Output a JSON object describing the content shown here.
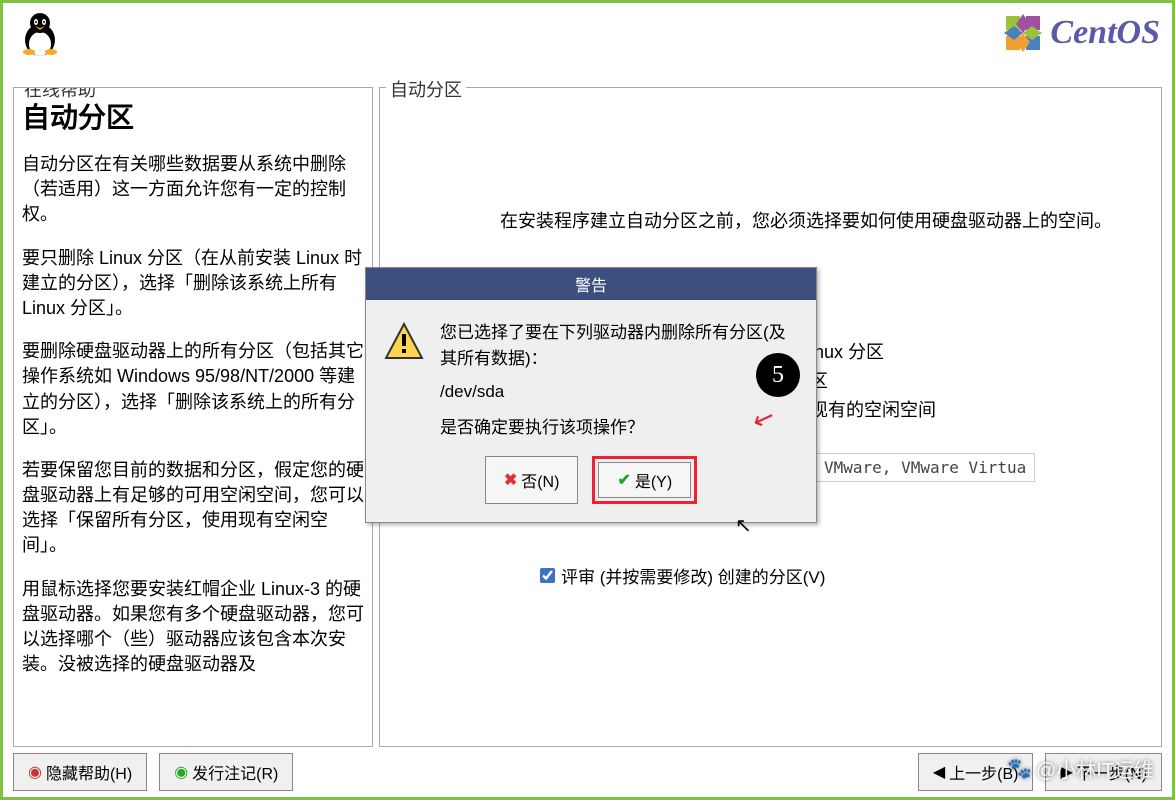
{
  "brand": {
    "name": "CentOS"
  },
  "help": {
    "label": "在线帮助",
    "title": "自动分区",
    "paragraphs": [
      "自动分区在有关哪些数据要从系统中删除（若适用）这一方面允许您有一定的控制权。",
      "要只删除 Linux 分区（在从前安装 Linux 时建立的分区），选择「删除该系统上所有 Linux 分区」。",
      "要删除硬盘驱动器上的所有分区（包括其它操作系统如 Windows 95/98/NT/2000 等建立的分区），选择「删除该系统上的所有分区」。",
      "若要保留您目前的数据和分区，假定您的硬盘驱动器上有足够的可用空闲空间，您可以选择「保留所有分区，使用现有空闲空间」。",
      "用鼠标选择您要安装红帽企业 Linux-3 的硬盘驱动器。如果您有多个硬盘驱动器，您可以选择哪个（些）驱动器应该包含本次安装。没被选择的硬盘驱动器及"
    ]
  },
  "main": {
    "label": "自动分区",
    "intro": "在安装程序建立自动分区之前，您必须选择要如何使用硬盘驱动器上的空间。",
    "options": [
      "inux 分区",
      "区",
      "现有的空闲空间"
    ],
    "drive_text": "VMware, VMware Virtua",
    "checkbox": "评审 (并按需要修改) 创建的分区(V)"
  },
  "dialog": {
    "title": "警告",
    "message": "您已选择了要在下列驱动器内删除所有分区(及其所有数据)：",
    "device": "/dev/sda",
    "confirm": "是否确定要执行该项操作？",
    "no": "否(N)",
    "yes": "是(Y)"
  },
  "footer": {
    "hide_help": "隐藏帮助(H)",
    "release_notes": "发行注记(R)",
    "back": "上一步(B)",
    "next": "下一步(N)"
  },
  "step": "5",
  "watermark": "@小林IT运维"
}
